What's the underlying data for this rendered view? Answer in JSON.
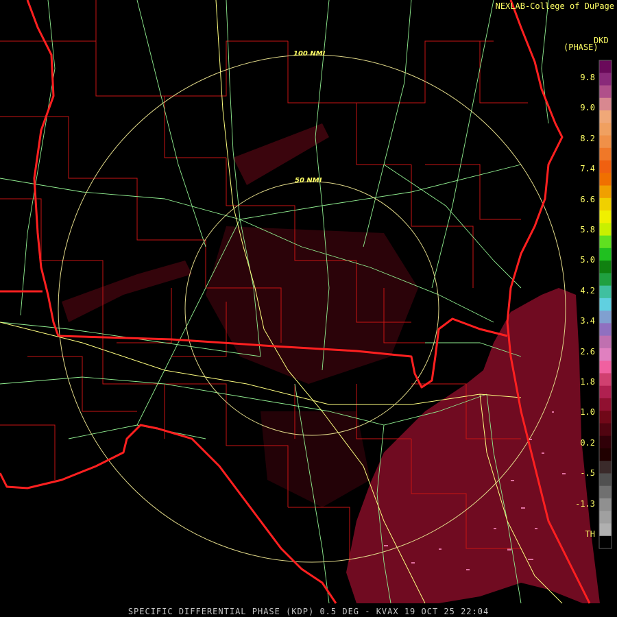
{
  "credit": "NEXLAB-College of DuPage",
  "product_code": "DKD",
  "units_label": "(PHASE)",
  "footer": "SPECIFIC DIFFERENTIAL PHASE (KDP) 0.5 DEG - KVAX 19 OCT 25 22:04",
  "range_rings": [
    "100 NMI",
    "50 NMI"
  ],
  "legend": {
    "ticks": [
      "9.8",
      "9.0",
      "8.2",
      "7.4",
      "6.6",
      "5.8",
      "5.0",
      "4.2",
      "3.4",
      "2.6",
      "1.8",
      "1.0",
      "0.2",
      "-.5",
      "-1.3",
      "TH"
    ],
    "colors": [
      "#6a0a5a",
      "#8a2a7a",
      "#b0508a",
      "#d88890",
      "#f0a878",
      "#f0a060",
      "#f09048",
      "#f07828",
      "#f06010",
      "#f07000",
      "#f0a000",
      "#f0d000",
      "#f0f000",
      "#c8f000",
      "#60e020",
      "#20c020",
      "#108010",
      "#20a040",
      "#40c0a0",
      "#60d0e0",
      "#80a0d0",
      "#9070c0",
      "#c070b0",
      "#e080c0",
      "#f060a0",
      "#d04070",
      "#b02050",
      "#901030",
      "#700818",
      "#500410",
      "#300008",
      "#200000",
      "#3a2a2a",
      "#505050",
      "#707070",
      "#909090",
      "#a0a0a0",
      "#b0b0b0",
      "#000000"
    ]
  },
  "colors": {
    "state_border": "#ff2020",
    "county_border": "#c81414",
    "highway": "#90ee90",
    "interstate": "#ffff80",
    "range_ring": "#e0d888",
    "echo": "#8c0f2a",
    "text": "#ffff66"
  }
}
